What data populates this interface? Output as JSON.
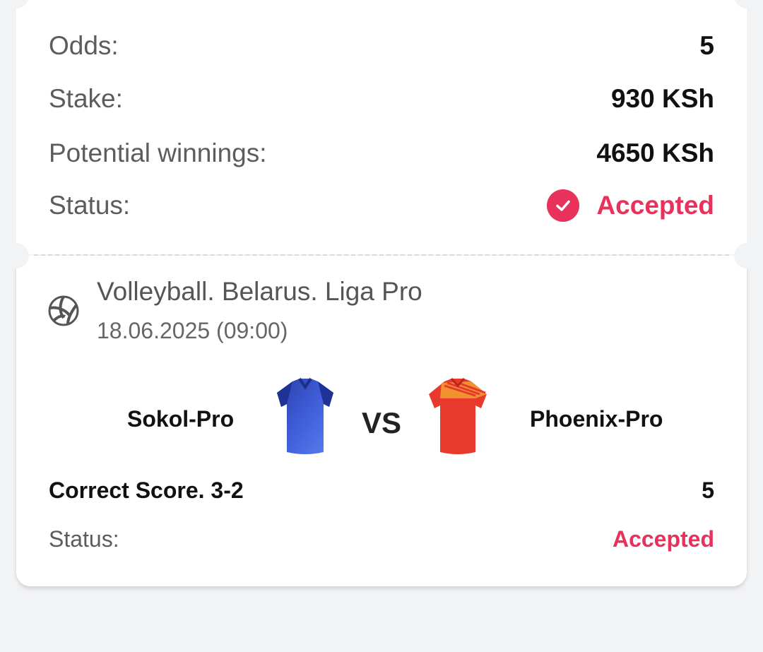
{
  "summary": {
    "odds_label": "Odds:",
    "odds_value": "5",
    "stake_label": "Stake:",
    "stake_value": "930 KSh",
    "winnings_label": "Potential winnings:",
    "winnings_value": "4650 KSh",
    "status_label": "Status:",
    "status_value": "Accepted"
  },
  "event": {
    "league": "Volleyball. Belarus. Liga Pro",
    "datetime": "18.06.2025 (09:00)",
    "home_team": "Sokol-Pro",
    "vs": "VS",
    "away_team": "Phoenix-Pro",
    "market": "Correct Score. 3-2",
    "market_odds": "5",
    "status_label": "Status:",
    "status_value": "Accepted"
  },
  "icons": {
    "status": "check-circle-icon",
    "sport": "volleyball-icon"
  },
  "colors": {
    "accent": "#e8315b",
    "background": "#f2f3f5",
    "home_jersey": "#3f5ed9",
    "away_jersey": "#e83a2c"
  }
}
